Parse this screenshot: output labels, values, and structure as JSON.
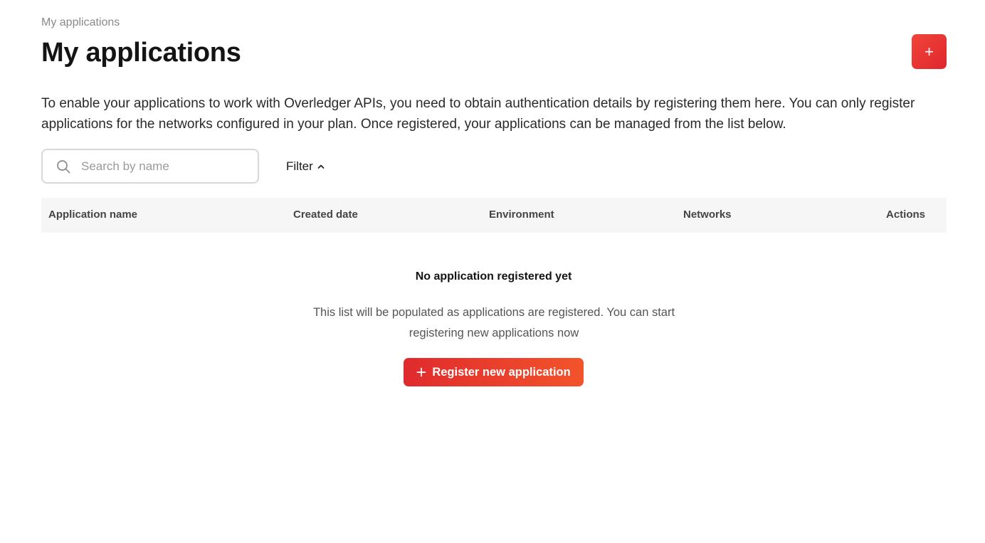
{
  "breadcrumb": "My applications",
  "page_title": "My applications",
  "add_button_label": "+",
  "description": "To enable your applications to work with Overledger APIs, you need to obtain authentication details by registering them here. You can only register applications for the networks configured in your plan. Once registered, your applications can be managed from the list below.",
  "search": {
    "placeholder": "Search by name",
    "value": "",
    "icon": "search-icon"
  },
  "filter": {
    "label": "Filter",
    "icon": "chevron-up-icon"
  },
  "table": {
    "columns": [
      "Application name",
      "Created date",
      "Environment",
      "Networks",
      "Actions"
    ],
    "rows": []
  },
  "empty_state": {
    "title": "No application registered yet",
    "text_line1": "This list will be populated as applications are registered. You can start",
    "text_line2": "registering new applications now",
    "button_label": "Register new application",
    "button_icon": "plus-icon"
  },
  "colors": {
    "accent": "#e8332e",
    "accent_end": "#f2542b",
    "header_bg": "#f6f6f6"
  }
}
